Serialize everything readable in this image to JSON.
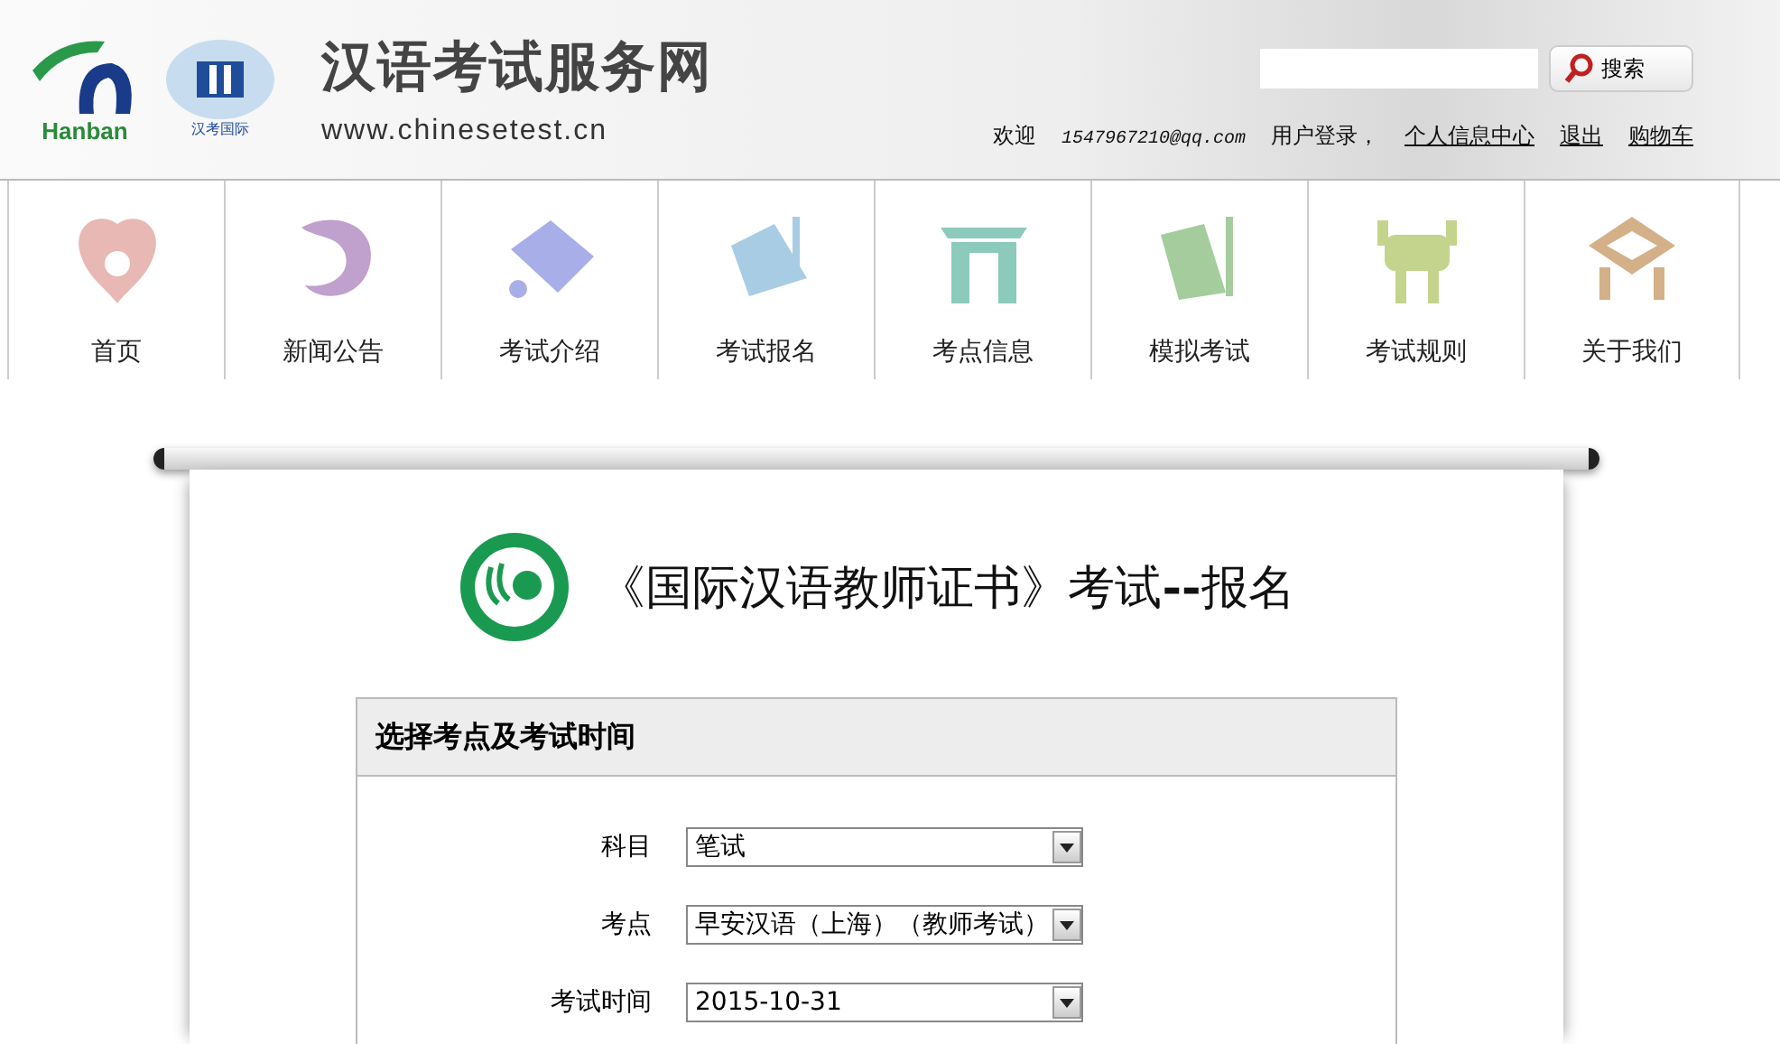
{
  "header": {
    "logo_text": "Hanban",
    "badge_text": "汉考国际",
    "site_title": "汉语考试服务网",
    "site_url": "www.chinesetest.cn",
    "search": {
      "button": "搜索"
    },
    "user_bar": [
      {
        "kind": "text",
        "text": "欢迎"
      },
      {
        "kind": "email",
        "text": "1547967210@qq.com"
      },
      {
        "kind": "text",
        "text": "用户登录，"
      },
      {
        "kind": "link",
        "text": "个人信息中心"
      },
      {
        "kind": "link",
        "text": "退出"
      },
      {
        "kind": "link",
        "text": "购物车"
      }
    ]
  },
  "nav": [
    {
      "label": "首页",
      "color": "#e8b8b4"
    },
    {
      "label": "新闻公告",
      "color": "#c0a0cc"
    },
    {
      "label": "考试介绍",
      "color": "#a8aee8"
    },
    {
      "label": "考试报名",
      "color": "#a8cce4"
    },
    {
      "label": "考点信息",
      "color": "#8ccabc"
    },
    {
      "label": "模拟考试",
      "color": "#a4cc9c"
    },
    {
      "label": "考试规则",
      "color": "#c4d48c"
    },
    {
      "label": "关于我们",
      "color": "#d4b088"
    }
  ],
  "page_title": "《国际汉语教师证书》考试**--**报名",
  "form": {
    "heading": "选择考点及考试时间",
    "fields": [
      {
        "label": "科目",
        "value": "笔试"
      },
      {
        "label": "考点",
        "value": "早安汉语（上海）（教师考试）"
      },
      {
        "label": "考试时间",
        "value": "2015-10-31"
      }
    ]
  }
}
